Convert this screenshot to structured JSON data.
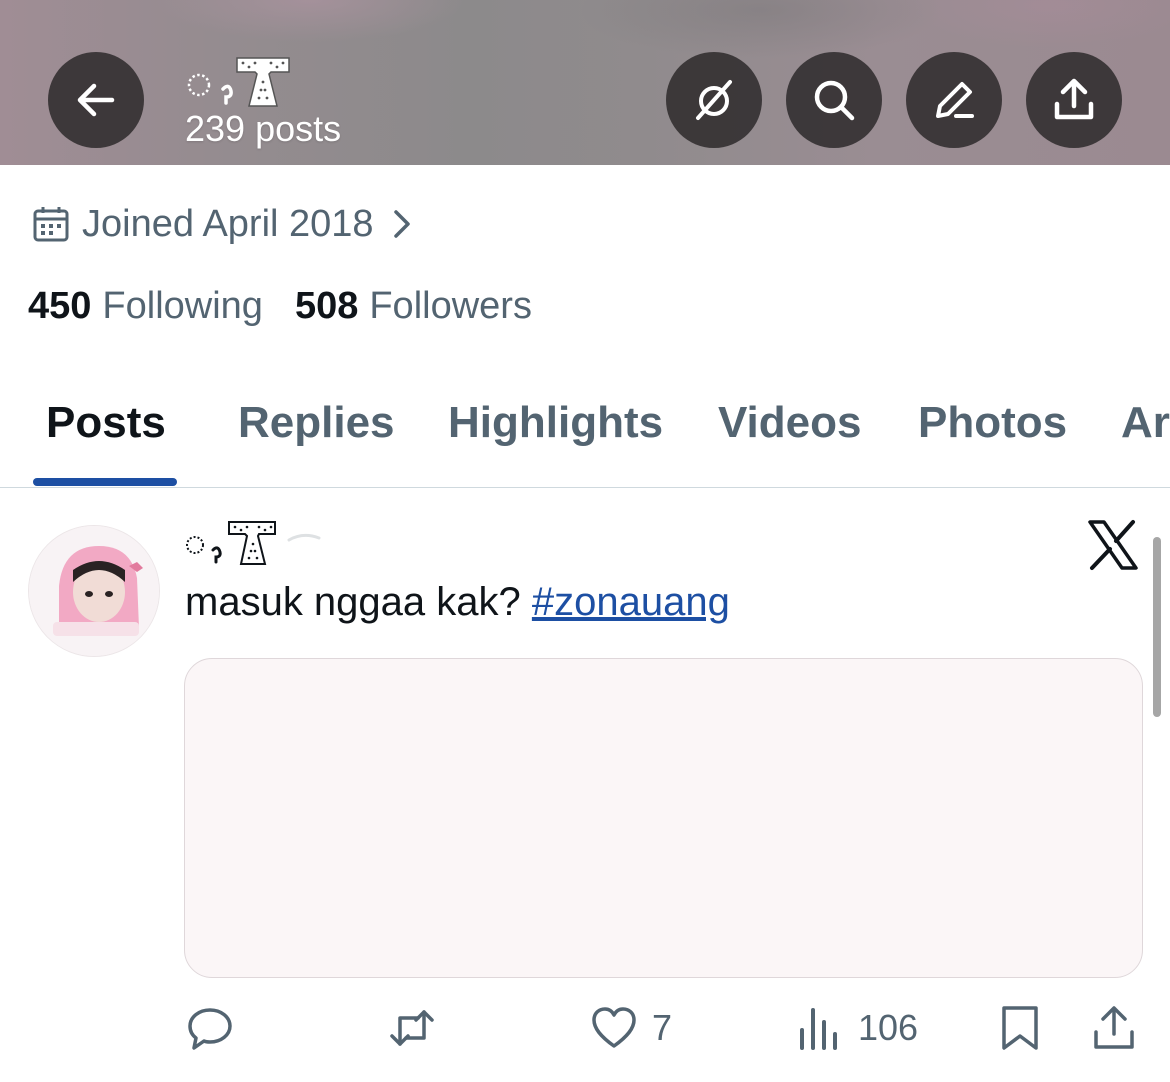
{
  "header": {
    "title_glyph_icon": "bow-ribbon-icon",
    "posts_count": "239 posts",
    "buttons": [
      "back-arrow-icon",
      "grok-icon",
      "search-icon",
      "edit-pen-icon",
      "share-upload-icon"
    ]
  },
  "profile": {
    "joined": "Joined April 2018",
    "following_count": "450",
    "following_label": "Following",
    "followers_count": "508",
    "followers_label": "Followers"
  },
  "tabs": [
    {
      "label": "Posts",
      "active": true
    },
    {
      "label": "Replies",
      "active": false
    },
    {
      "label": "Highlights",
      "active": false
    },
    {
      "label": "Videos",
      "active": false
    },
    {
      "label": "Photos",
      "active": false
    },
    {
      "label": "Ar",
      "active": false
    }
  ],
  "post": {
    "text": "masuk nggaa kak? ",
    "hashtag": "#zonauang",
    "actions": {
      "reply_count": "",
      "repost_count": "",
      "like_count": "7",
      "views_count": "106"
    },
    "logo_icon": "x-logo-icon"
  },
  "colors": {
    "accent": "#1d4fa3",
    "text_primary": "#0f1419",
    "text_secondary": "#536471",
    "header_button_bg": "#302c2e"
  }
}
